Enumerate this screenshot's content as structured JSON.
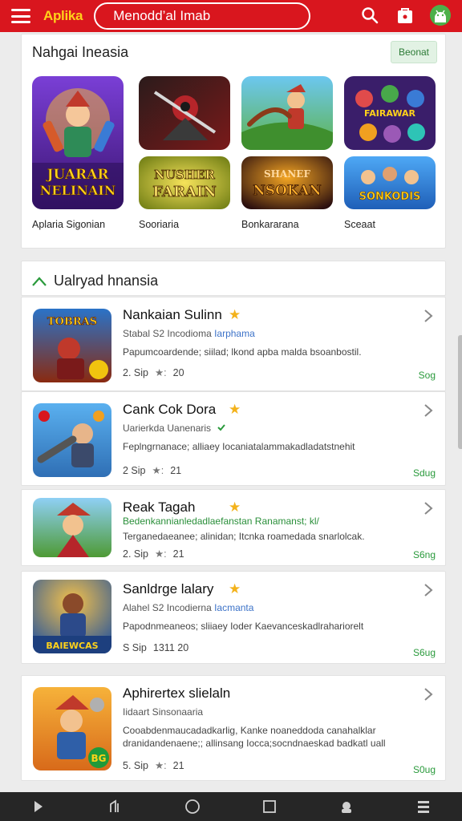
{
  "topbar": {
    "brand": "Aplika",
    "search_text": "Menodd’al Imab",
    "colors": {
      "bar": "#d9161e",
      "brand": "#ffd21a"
    },
    "icons": [
      "menu-icon",
      "search-icon",
      "bag-icon",
      "android-icon"
    ]
  },
  "featured": {
    "title": "Nahgai Ineasia",
    "more_label": "Beonat",
    "tiles": [
      {
        "caption": "Aplaria Sigonian",
        "art_text_1": "JUARAR",
        "art_text_2": "NELINAIN"
      },
      {
        "caption": ""
      },
      {
        "caption": ""
      },
      {
        "caption": ""
      },
      {
        "caption": "Sooriaria",
        "art_text_1": "NUSHER",
        "art_text_2": "FARAIN"
      },
      {
        "caption": "Bonkararana",
        "art_text_1": "SHANEF",
        "art_text_2": "NSOKAN"
      },
      {
        "caption": "Sceaat",
        "art_text_1": "SONKODIS",
        "art_text_2": ""
      }
    ],
    "tile3_art_text": "FAIRAWAR"
  },
  "list": {
    "title": "Ualryad hnansia",
    "apps": [
      {
        "name": "Nankaian Sulinn",
        "sub_prefix": "Stabal S2 Incodioma ",
        "sub_accent": "Iarphama",
        "desc": "Papumcoardende; siilad; lkond apba malda bsoanbostil.",
        "meta_a": "2. Sip",
        "meta_b": "20",
        "size": "Sog",
        "icon_text": "TOBRAS"
      },
      {
        "name": "Cank Cok Dora",
        "sub_prefix": "Uarierkda Uanenaris",
        "sub_accent": "",
        "desc": "Feplngrnanace; alliaey Iocaniatalammakadladatstnehit",
        "meta_a": "2 Sip",
        "meta_b": "21",
        "size": "Sdug",
        "icon_text": ""
      },
      {
        "name": "Reak Tagah",
        "sub_green": "Bedenkannianledadlaefanstan Ranamanst; kl/",
        "desc": "Terganedaeanee; alinidan; Itcnka roamedada snarlolcak.",
        "meta_a": "2. Sip",
        "meta_b": "21",
        "size": "S6ng",
        "icon_text": ""
      },
      {
        "name": "Sanldrge lalary",
        "sub_prefix": "Alahel S2 Incodierna ",
        "sub_accent": "Iacmanta",
        "desc": "Papodnmeaneos; sliiaey Ioder Kaevanceskadlrahariorelt",
        "meta_a": "S Sip",
        "meta_b": "1311  20",
        "size": "S6ug",
        "icon_text": "BAIEWCAS"
      },
      {
        "name": "Aphirertex slielaln",
        "sub_prefix": "Iidaart Sinsonaaria",
        "sub_accent": "",
        "desc": "Cooabdenmaucadadkarlig, Kanke noaneddoda canahalklar dranidandenaene;; allinsang Iocca;socndnaeskad badkatl uall",
        "meta_a": "5. Sip",
        "meta_b": "21",
        "size": "S0ug",
        "icon_text": "BG"
      }
    ]
  },
  "navbar": {
    "icons": [
      "back-icon",
      "recents-icon",
      "home-icon",
      "overview-icon",
      "settings-icon",
      "menu-icon"
    ]
  }
}
